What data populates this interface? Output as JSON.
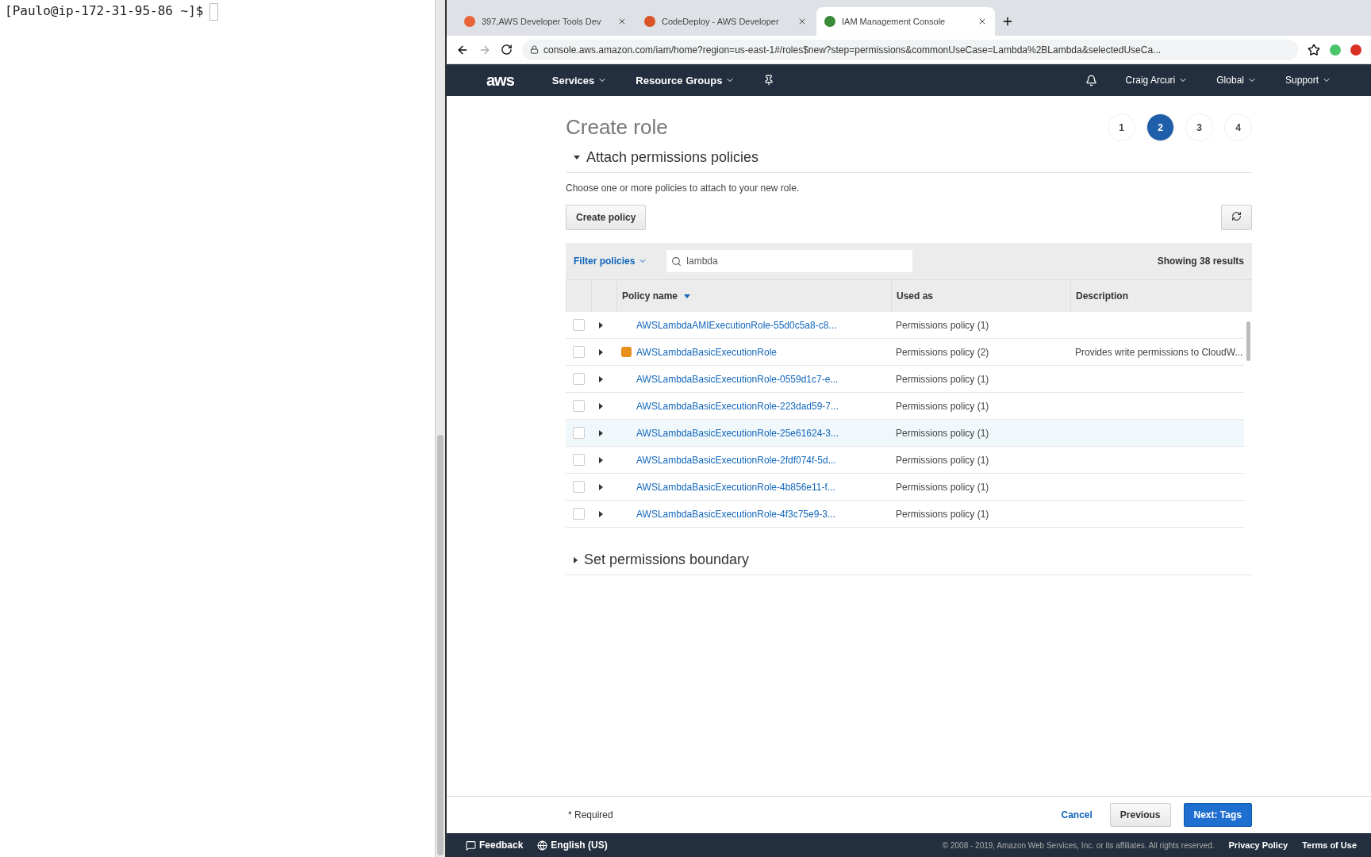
{
  "terminal": {
    "prompt": "[Paulo@ip-172-31-95-86 ~]$"
  },
  "browser": {
    "tabs": [
      {
        "title": "397,AWS Developer Tools Dev",
        "kind": "swirl",
        "selected": false
      },
      {
        "title": "CodeDeploy - AWS Developer",
        "kind": "cube",
        "selected": false
      },
      {
        "title": "IAM Management Console",
        "kind": "key",
        "selected": true
      }
    ],
    "address": "console.aws.amazon.com/iam/home?region=us-east-1#/roles$new?step=permissions&commonUseCase=Lambda%2BLambda&selectedUseCa..."
  },
  "nav": {
    "logo": "aws",
    "left": [
      "Services",
      "Resource Groups"
    ],
    "right": [
      "Craig Arcuri",
      "Global",
      "Support"
    ]
  },
  "page": {
    "title": "Create role",
    "steps": [
      {
        "label": "1",
        "selected": false
      },
      {
        "label": "2",
        "selected": true
      },
      {
        "label": "3",
        "selected": false
      },
      {
        "label": "4",
        "selected": false
      }
    ],
    "attach_section": {
      "title": "Attach permissions policies",
      "expanded": true,
      "description": "Choose one or more policies to attach to your new role.",
      "create_button": "Create policy",
      "filter": "Filter policies",
      "search_value": "lambda",
      "results": "Showing 38 results",
      "columns": [
        "Policy name",
        "Used as",
        "Description"
      ],
      "rows": [
        {
          "name": "AWSLambdaAMIExecutionRole-55d0c5a8-c8...",
          "used_as": "Permissions policy (1)",
          "checked": false,
          "managed": false,
          "hovered": false
        },
        {
          "name": "AWSLambdaBasicExecutionRole",
          "used_as": "Permissions policy (2)",
          "description": "Provides write permissions to CloudW...",
          "checked": false,
          "managed": true,
          "hovered": false
        },
        {
          "name": "AWSLambdaBasicExecutionRole-0559d1c7-e...",
          "used_as": "Permissions policy (1)",
          "checked": false,
          "managed": false,
          "hovered": false
        },
        {
          "name": "AWSLambdaBasicExecutionRole-223dad59-7...",
          "used_as": "Permissions policy (1)",
          "checked": false,
          "managed": false,
          "hovered": false
        },
        {
          "name": "AWSLambdaBasicExecutionRole-25e61624-3...",
          "used_as": "Permissions policy (1)",
          "checked": false,
          "managed": false,
          "hovered": true
        },
        {
          "name": "AWSLambdaBasicExecutionRole-2fdf074f-5d...",
          "used_as": "Permissions policy (1)",
          "checked": false,
          "managed": false,
          "hovered": false
        },
        {
          "name": "AWSLambdaBasicExecutionRole-4b856e11-f...",
          "used_as": "Permissions policy (1)",
          "checked": false,
          "managed": false,
          "hovered": false
        },
        {
          "name": "AWSLambdaBasicExecutionRole-4f3c75e9-3...",
          "used_as": "Permissions policy (1)",
          "checked": false,
          "managed": false,
          "hovered": false
        }
      ]
    },
    "boundary_section": {
      "title": "Set permissions boundary",
      "expanded": false
    },
    "required": "* Required",
    "buttons": {
      "cancel": "Cancel",
      "previous": "Previous",
      "next": "Next: Tags"
    }
  },
  "footer": {
    "feedback": "Feedback",
    "language": "English (US)",
    "copyright": "© 2008 - 2019, Amazon Web Services, Inc. or its affiliates. All rights reserved.",
    "links": [
      "Privacy Policy",
      "Terms of Use"
    ]
  }
}
